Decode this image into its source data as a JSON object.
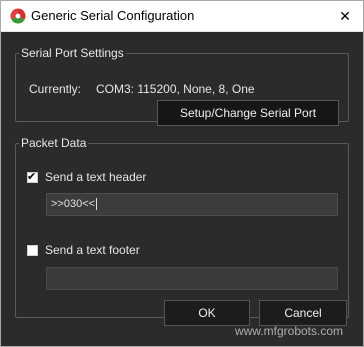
{
  "window": {
    "title": "Generic Serial Configuration",
    "close_glyph": "✕",
    "icon": "app-logo-icon"
  },
  "serial_port": {
    "legend": "Serial Port Settings",
    "currently_label": "Currently:",
    "currently_value": "COM3: 115200, None, 8, One",
    "setup_button": "Setup/Change Serial Port"
  },
  "packet_data": {
    "legend": "Packet Data",
    "header": {
      "label": "Send a text header",
      "checked": true,
      "value": ">>030<<"
    },
    "footer": {
      "label": "Send a text footer",
      "checked": false,
      "value": ""
    }
  },
  "buttons": {
    "ok": "OK",
    "cancel": "Cancel"
  },
  "watermark": "www.mfgrobots.com"
}
